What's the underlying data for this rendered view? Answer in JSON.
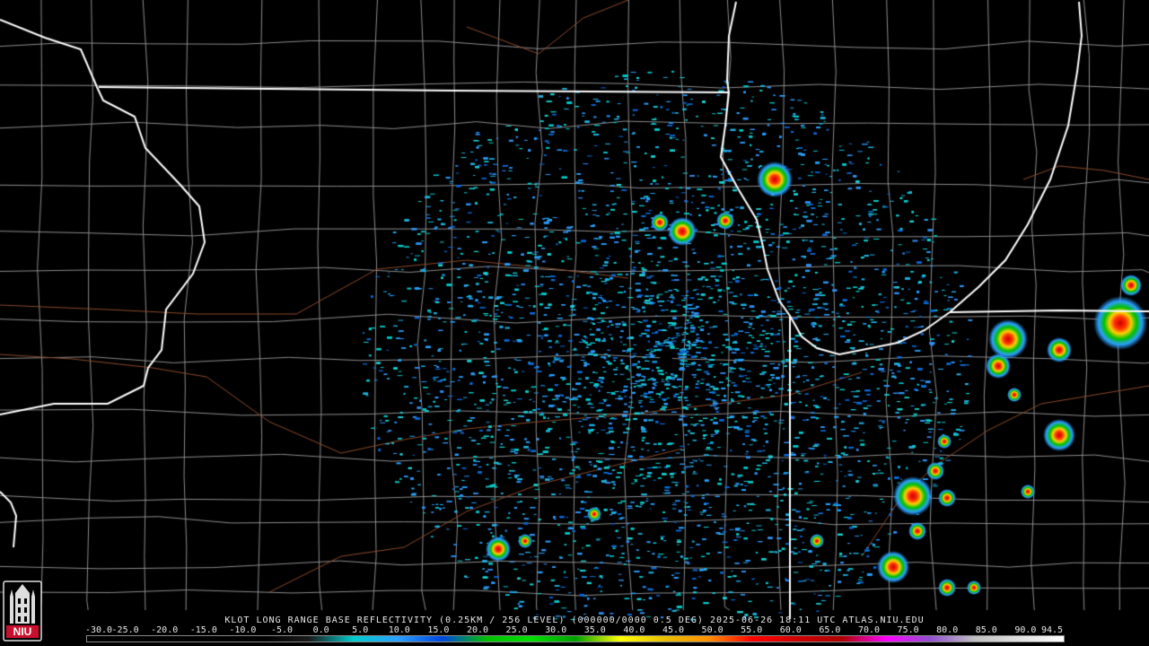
{
  "caption": "KLOT LONG RANGE BASE REFLECTIVITY (0.25KM / 256 LEVEL) (000000/0000 0.5 DEG) 2025-06-26 18:11 UTC  ATLAS.NIU.EDU",
  "scale": {
    "labels": [
      "-30.0",
      "-25.0",
      "-20.0",
      "-15.0",
      "-10.0",
      "-5.0",
      "0.0",
      "5.0",
      "10.0",
      "15.0",
      "20.0",
      "25.0",
      "30.0",
      "35.0",
      "40.0",
      "45.0",
      "50.0",
      "55.0",
      "60.0",
      "65.0",
      "70.0",
      "75.0",
      "80.0",
      "85.0",
      "90.0",
      "94.5"
    ],
    "min": -30.0,
    "max": 94.5,
    "colors": [
      "#000000",
      "#000000",
      "#000000",
      "#000000",
      "#000000",
      "#1a1a1a",
      "#00cccc",
      "#2aa0ff",
      "#0046e0",
      "#00c000",
      "#00e000",
      "#00a000",
      "#ffff00",
      "#e8c000",
      "#ff9000",
      "#ff0000",
      "#d00000",
      "#b00000",
      "#ff00ff",
      "#9050d0",
      "#c0c0c0",
      "#e0e0e0",
      "#ffffff"
    ]
  },
  "map": {
    "radar_site": "KLOT",
    "colors": {
      "state_border": "#ffffff",
      "county_border": "#8c8c8c",
      "river": "#8b4a2b",
      "background": "#000000"
    }
  },
  "logo": {
    "text": "NIU",
    "color": "#c8102e"
  }
}
